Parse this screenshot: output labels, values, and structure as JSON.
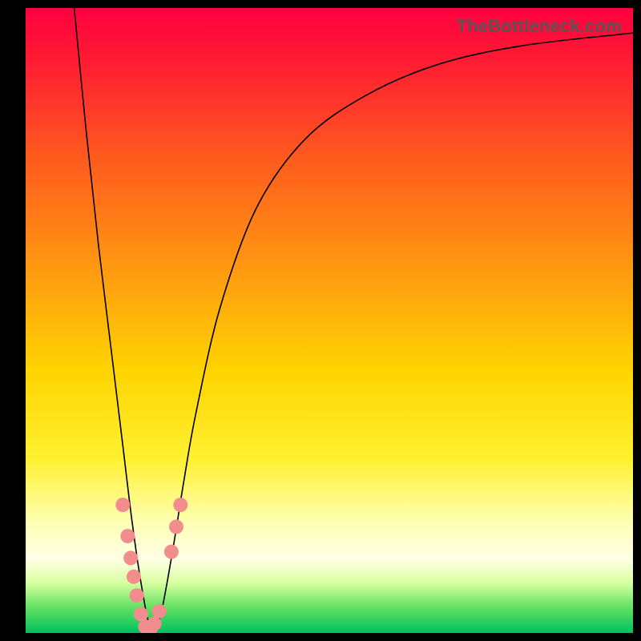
{
  "attribution": "TheBottleneck.com",
  "chart_data": {
    "type": "line",
    "title": "",
    "xlabel": "",
    "ylabel": "",
    "xlim": [
      0,
      100
    ],
    "ylim": [
      0,
      100
    ],
    "series": [
      {
        "name": "bottleneck-curve",
        "x": [
          8,
          10,
          12,
          14,
          16,
          17.5,
          19,
          20.5,
          22,
          24,
          26,
          28,
          32,
          38,
          46,
          56,
          68,
          82,
          100
        ],
        "y": [
          100,
          80,
          62,
          46,
          30,
          18,
          8,
          1,
          2,
          12,
          24,
          35,
          52,
          68,
          79,
          86,
          91,
          94,
          96
        ]
      }
    ],
    "markers": {
      "color": "#f38d8d",
      "points": [
        {
          "x": 16.0,
          "y": 20.5
        },
        {
          "x": 16.8,
          "y": 15.5
        },
        {
          "x": 17.3,
          "y": 12.0
        },
        {
          "x": 17.8,
          "y": 9.0
        },
        {
          "x": 18.3,
          "y": 6.0
        },
        {
          "x": 19.0,
          "y": 3.0
        },
        {
          "x": 19.7,
          "y": 1.0
        },
        {
          "x": 20.5,
          "y": 0.5
        },
        {
          "x": 21.2,
          "y": 1.5
        },
        {
          "x": 22.0,
          "y": 3.5
        },
        {
          "x": 24.0,
          "y": 13.0
        },
        {
          "x": 24.8,
          "y": 17.0
        },
        {
          "x": 25.5,
          "y": 20.5
        }
      ]
    },
    "gradient_bands": [
      {
        "stop": 0,
        "meaning": "severe-bottleneck",
        "color": "#ff0040"
      },
      {
        "stop": 50,
        "meaning": "moderate-bottleneck",
        "color": "#ffc000"
      },
      {
        "stop": 88,
        "meaning": "minimal-bottleneck",
        "color": "#ffffe0"
      },
      {
        "stop": 100,
        "meaning": "no-bottleneck",
        "color": "#00c060"
      }
    ]
  }
}
